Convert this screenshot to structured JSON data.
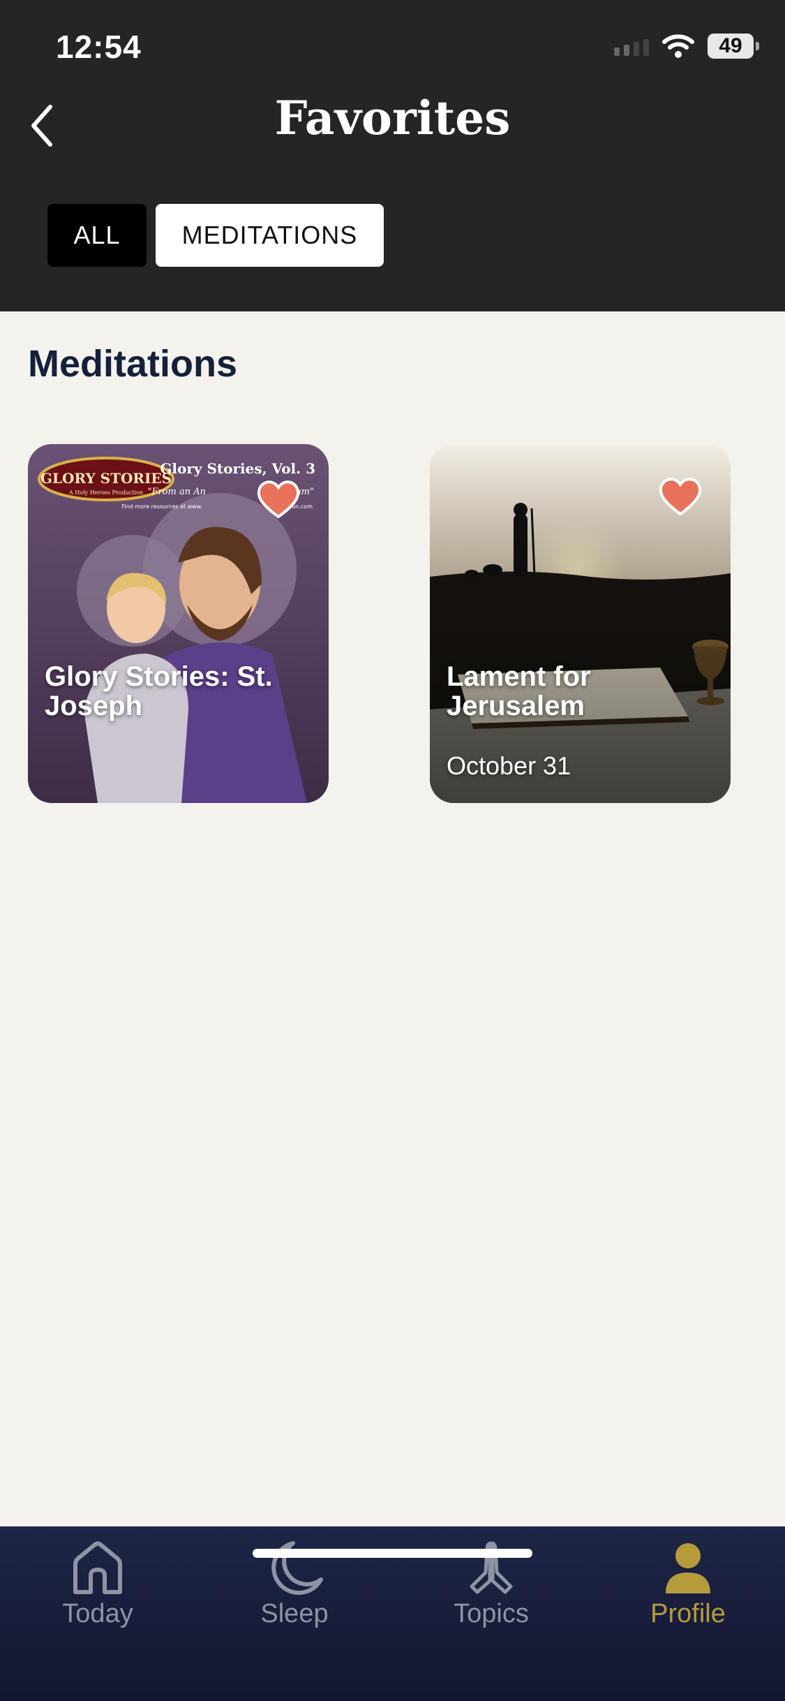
{
  "status": {
    "time": "12:54",
    "battery": "49"
  },
  "header": {
    "title": "Favorites"
  },
  "filters": [
    {
      "label": "ALL"
    },
    {
      "label": "MEDITATIONS"
    }
  ],
  "section": {
    "title": "Meditations"
  },
  "cards": [
    {
      "title": "Glory Stories: St. Joseph",
      "art_brand": "GLORY STORIES",
      "art_brand_sub": "A Holy Heroes Production",
      "art_series": "Glory Stories, Vol. 3",
      "art_subtitle": "\"From an An",
      "art_subtitle_end": "um\"",
      "art_note": "Find more resources at www.",
      "art_note_end": "sFun.com",
      "favorited": true
    },
    {
      "title": "Lament for Jerusalem",
      "date": "October 31",
      "favorited": true
    }
  ],
  "tabs": [
    {
      "label": "Today",
      "icon": "home-icon"
    },
    {
      "label": "Sleep",
      "icon": "moon-icon"
    },
    {
      "label": "Topics",
      "icon": "praying-hands-icon"
    },
    {
      "label": "Profile",
      "icon": "person-icon",
      "active": true
    }
  ],
  "colors": {
    "accent": "#B59B3C",
    "heart": "#E8725A",
    "header_bg": "#252525",
    "page_bg": "#F3F2EC",
    "tabbar_bg": "#1A2040"
  }
}
